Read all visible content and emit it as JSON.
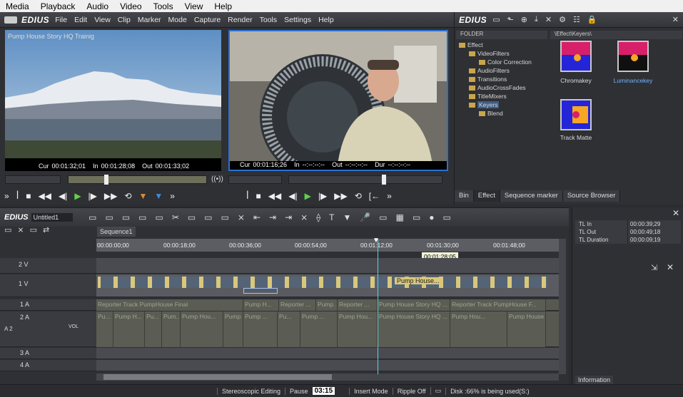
{
  "menubar": {
    "items": [
      "Media",
      "Playback",
      "Audio",
      "Video",
      "Tools",
      "View",
      "Help"
    ]
  },
  "main": {
    "logo": "EDIUS",
    "menu": [
      "File",
      "Edit",
      "View",
      "Clip",
      "Marker",
      "Mode",
      "Capture",
      "Render",
      "Tools",
      "Settings",
      "Help"
    ]
  },
  "player": {
    "title": "Pump House Story HQ Trainig",
    "cur_label": "Cur",
    "cur": "00:01:32;01",
    "in_label": "In",
    "in": "00:01:28;08",
    "out_label": "Out",
    "out": "00:01:33;02"
  },
  "recorder": {
    "cur_label": "Cur",
    "cur": "00:01:16;26",
    "in_label": "In",
    "in": "--:--:--:--",
    "out_label": "Out",
    "out": "--:--:--:--",
    "dur_label": "Dur",
    "dur": "--:--:--:--"
  },
  "bin": {
    "logo": "EDIUS",
    "folder_header": "FOLDER",
    "path": "\\Effect\\Keyers\\",
    "tree": [
      "Effect",
      "VideoFilters",
      "Color Correction",
      "AudioFilters",
      "Transitions",
      "AudioCrossFades",
      "TitleMixers",
      "Keyers",
      "Blend"
    ],
    "effects": [
      "Chromakey",
      "Luminancekey",
      "Track Matte"
    ],
    "tabs": [
      "Bin",
      "Effect",
      "Sequence marker",
      "Source Browser"
    ]
  },
  "timeline": {
    "logo": "EDIUS",
    "project": "Untitled1",
    "sequence_tab": "Sequence1",
    "ruler": [
      "00:00:00;00",
      "00:00:18;00",
      "00:00:36;00",
      "00:00:54;00",
      "00:01:12;00",
      "00:01:30;00",
      "00:01:48;00"
    ],
    "tooltip": "00:01:28;05",
    "tracks": [
      "2 V",
      "1 V",
      "1 A",
      "2 A",
      "3 A",
      "4 A"
    ],
    "a2_label": "A 2",
    "vol": "VOL",
    "v1_clip": "Pump House...",
    "a1_clips": [
      "Reporter Track PumpHouse Final",
      "Pump H...",
      "Reporter ...",
      "Pump ...",
      "Reporter ...",
      "Pump House Story HQ ...",
      "Reporter Track PumpHouse F..."
    ],
    "a2_clips": [
      "Pu...",
      "Pump H...",
      "Pu...",
      "Pum...",
      "Pump Hou...",
      "Pump ...",
      "Pump ...",
      "Pu...",
      "Pump ...",
      "Pump Hou...",
      "Pump House Story HQ ...",
      "Pump Hou...",
      "Pump House S..."
    ]
  },
  "info": {
    "rows": [
      {
        "k": "TL In",
        "v": "00:00:39;29"
      },
      {
        "k": "TL Out",
        "v": "00:00:49;18"
      },
      {
        "k": "TL Duration",
        "v": "00:00:09;19"
      }
    ],
    "tab": "Information"
  },
  "status": {
    "items": [
      "Stereoscopic Editing",
      "Pause",
      "Insert Mode",
      "Ripple Off",
      "Disk :66% is being used(S:)"
    ],
    "time": "03:15"
  }
}
